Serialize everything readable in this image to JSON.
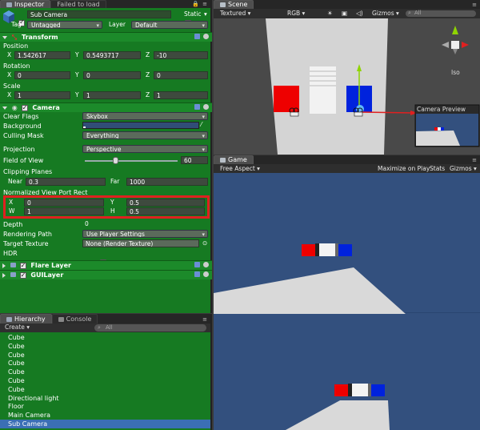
{
  "inspector": {
    "tab_label": "Inspector",
    "tab2_label": "Failed to load",
    "object_name": "Sub Camera",
    "static_label": "Static",
    "tag_label": "Tag",
    "tag_value": "Untagged",
    "layer_label": "Layer",
    "layer_value": "Default"
  },
  "transform": {
    "title": "Transform",
    "position_label": "Position",
    "position": {
      "x_label": "X",
      "x": "1.542617",
      "y_label": "Y",
      "y": "0.5493717",
      "z_label": "Z",
      "z": "-10"
    },
    "rotation_label": "Rotation",
    "rotation": {
      "x_label": "X",
      "x": "0",
      "y_label": "Y",
      "y": "0",
      "z_label": "Z",
      "z": "0"
    },
    "scale_label": "Scale",
    "scale": {
      "x_label": "X",
      "x": "1",
      "y_label": "Y",
      "y": "1",
      "z_label": "Z",
      "z": "1"
    }
  },
  "camera": {
    "title": "Camera",
    "clear_flags_label": "Clear Flags",
    "clear_flags_value": "Skybox",
    "background_label": "Background",
    "culling_mask_label": "Culling Mask",
    "culling_mask_value": "Everything",
    "projection_label": "Projection",
    "projection_value": "Perspective",
    "fov_label": "Field of View",
    "fov_value": "60",
    "fov_fraction": 0.33,
    "clipping_label": "Clipping Planes",
    "near_label": "Near",
    "near_value": "0.3",
    "far_label": "Far",
    "far_value": "1000",
    "viewport_label": "Normalized View Port Rect",
    "viewport": {
      "x_label": "X",
      "x": "0",
      "y_label": "Y",
      "y": "0.5",
      "w_label": "W",
      "w": "1",
      "h_label": "H",
      "h": "0.5"
    },
    "depth_label": "Depth",
    "depth_value": "0",
    "rendering_path_label": "Rendering Path",
    "rendering_path_value": "Use Player Settings",
    "target_texture_label": "Target Texture",
    "target_texture_value": "None (Render Texture)",
    "hdr_label": "HDR"
  },
  "components": {
    "flare_layer": "Flare Layer",
    "gui_layer": "GUILayer"
  },
  "hierarchy": {
    "tab_label": "Hierarchy",
    "tab2_label": "Console",
    "create_label": "Create",
    "search_placeholder": "All",
    "items": [
      "Cube",
      "Cube",
      "Cube",
      "Cube",
      "Cube",
      "Cube",
      "Cube",
      "Directional light",
      "Floor",
      "Main Camera",
      "Sub Camera"
    ],
    "selected_index": 10
  },
  "scene": {
    "tab_label": "Scene",
    "render_mode": "Textured",
    "color_mode": "RGB",
    "gizmos_label": "Gizmos",
    "search_placeholder": "All",
    "iso_label": "Iso",
    "preview_title": "Camera Preview"
  },
  "game": {
    "tab_label": "Game",
    "aspect_label": "Free Aspect",
    "maximize_label": "Maximize on Play",
    "stats_label": "Stats",
    "gizmos_label": "Gizmos"
  },
  "colors": {
    "panel_green": "#167a22",
    "highlight_red": "#e02020",
    "sky_blue": "#2f4a7a",
    "cube_red": "#ee0000",
    "cube_blue": "#0022dd",
    "selection": "#3b6fb5"
  }
}
